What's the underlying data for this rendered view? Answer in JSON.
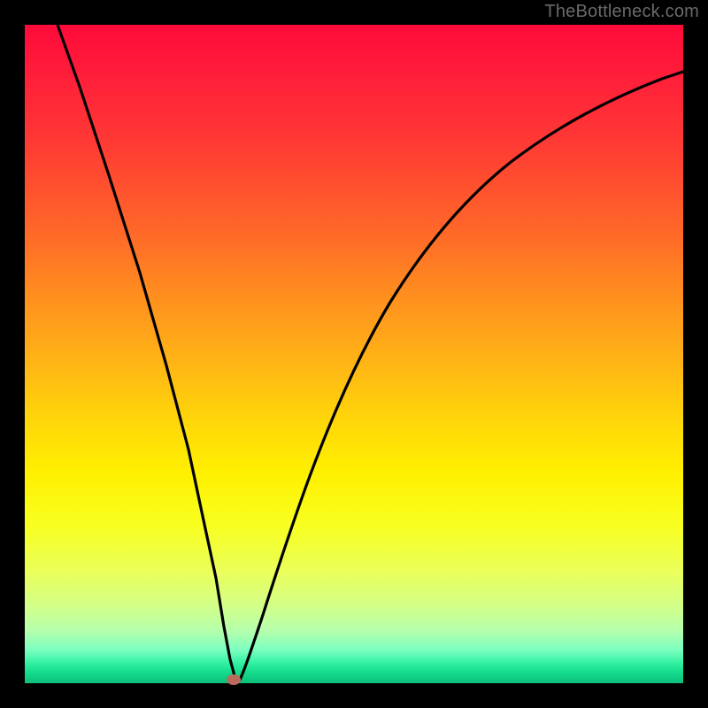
{
  "watermark": {
    "text": "TheBottleneck.com"
  },
  "chart_data": {
    "type": "line",
    "title": "",
    "xlabel": "",
    "ylabel": "",
    "xlim": [
      0,
      100
    ],
    "ylim": [
      0,
      100
    ],
    "grid": false,
    "legend": false,
    "background_gradient": {
      "direction": "vertical",
      "stops": [
        {
          "pos": 0.0,
          "color": "#ff0a3a"
        },
        {
          "pos": 0.18,
          "color": "#ff3a34"
        },
        {
          "pos": 0.42,
          "color": "#ff921e"
        },
        {
          "pos": 0.6,
          "color": "#ffd60a"
        },
        {
          "pos": 0.76,
          "color": "#f8ff20"
        },
        {
          "pos": 0.92,
          "color": "#b6ffac"
        },
        {
          "pos": 1.0,
          "color": "#0dbf7a"
        }
      ]
    },
    "series": [
      {
        "name": "bottleneck-curve",
        "x": [
          5,
          10,
          15,
          20,
          25,
          28,
          30,
          31,
          32,
          33,
          35,
          38,
          42,
          48,
          55,
          62,
          70,
          80,
          90,
          100
        ],
        "y": [
          100,
          80,
          55,
          33,
          14,
          5,
          1,
          0,
          0.5,
          2,
          8,
          20,
          35,
          50,
          62,
          70,
          77,
          83,
          88,
          92
        ]
      }
    ],
    "marker": {
      "x": 31,
      "y": 0,
      "color": "#b96b5e"
    }
  }
}
